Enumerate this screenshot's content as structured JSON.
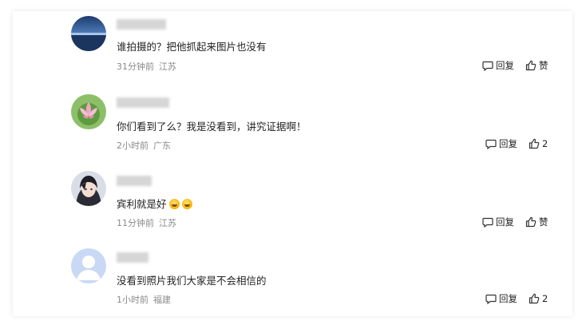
{
  "comments": [
    {
      "text": "谁拍摄的？把他抓起来图片也没有",
      "time": "31分钟前",
      "location": "江苏",
      "reply_label": "回复",
      "like_count": "赞",
      "avatar": "lake-landscape"
    },
    {
      "text": "你们看到了么？我是没看到，讲究证据啊！",
      "time": "2小时前",
      "location": "广东",
      "reply_label": "回复",
      "like_count": "2",
      "avatar": "pink-lotus"
    },
    {
      "text": "宾利就是好",
      "emoji": [
        "laughing-crying-emoji",
        "laughing-crying-emoji"
      ],
      "time": "11分钟前",
      "location": "江苏",
      "reply_label": "回复",
      "like_count": "赞",
      "avatar": "anime-character"
    },
    {
      "text": "没看到照片我们大家是不会相信的",
      "time": "1小时前",
      "location": "福建",
      "reply_label": "回复",
      "like_count": "2",
      "avatar": "default-user"
    }
  ],
  "colors": {
    "meta": "#8a8a8a",
    "text": "#222222",
    "default_avatar": "#c9d9f5"
  }
}
